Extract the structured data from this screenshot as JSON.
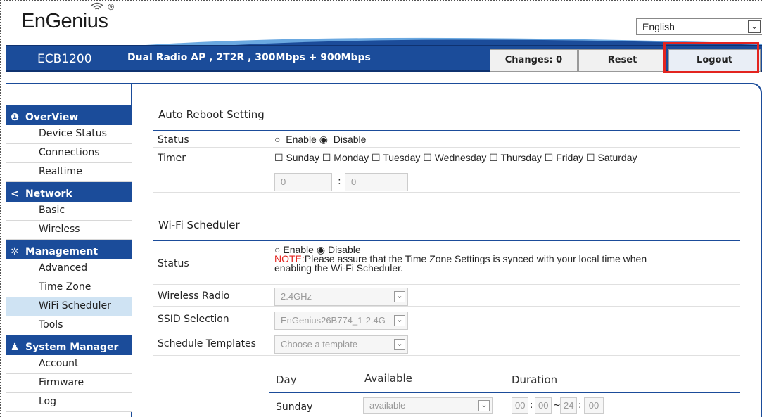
{
  "header": {
    "brand": "EnGenius",
    "brand_mark": "®",
    "language": "English",
    "model": "ECB1200",
    "description": "Dual Radio AP , 2T2R , 300Mbps + 900Mbps",
    "changes_label": "Changes: 0",
    "reset_label": "Reset",
    "logout_label": "Logout",
    "highlight_color": "#e3241f",
    "accent_color": "#1b4c9a"
  },
  "sidebar": {
    "groups": [
      {
        "title": "OverView",
        "icon": "info-icon",
        "items": [
          "Device Status",
          "Connections",
          "Realtime"
        ]
      },
      {
        "title": "Network",
        "icon": "share-icon",
        "items": [
          "Basic",
          "Wireless"
        ]
      },
      {
        "title": "Management",
        "icon": "gear-icon",
        "items": [
          "Advanced",
          "Time Zone",
          "WiFi Scheduler",
          "Tools"
        ]
      },
      {
        "title": "System Manager",
        "icon": "user-icon",
        "items": [
          "Account",
          "Firmware",
          "Log"
        ]
      }
    ],
    "active_item": "WiFi Scheduler"
  },
  "auto_reboot": {
    "title": "Auto Reboot Setting",
    "status_label": "Status",
    "enable_label": "Enable",
    "disable_label": "Disable",
    "status_value": "Disable",
    "timer_label": "Timer",
    "days": [
      "Sunday",
      "Monday",
      "Tuesday",
      "Wednesday",
      "Thursday",
      "Friday",
      "Saturday"
    ],
    "hour": "0",
    "minute": "0"
  },
  "wifi_scheduler": {
    "title": "Wi-Fi Scheduler",
    "status_label": "Status",
    "enable_label": "Enable",
    "disable_label": "Disable",
    "status_value": "Disable",
    "note_prefix": "NOTE:",
    "note_text": "Please assure that the Time Zone Settings is synced with your local time when",
    "note_text2": "enabling the Wi-Fi Scheduler.",
    "radio_label": "Wireless Radio",
    "radio_value": "2.4GHz",
    "ssid_label": "SSID Selection",
    "ssid_value": "EnGenius26B774_1-2.4G",
    "template_label": "Schedule Templates",
    "template_value": "Choose a template",
    "col_day": "Day",
    "col_available": "Available",
    "col_duration": "Duration",
    "rows": [
      {
        "day": "Sunday",
        "available": "available",
        "start_h": "00",
        "start_m": "00",
        "end_h": "24",
        "end_m": "00"
      }
    ]
  }
}
